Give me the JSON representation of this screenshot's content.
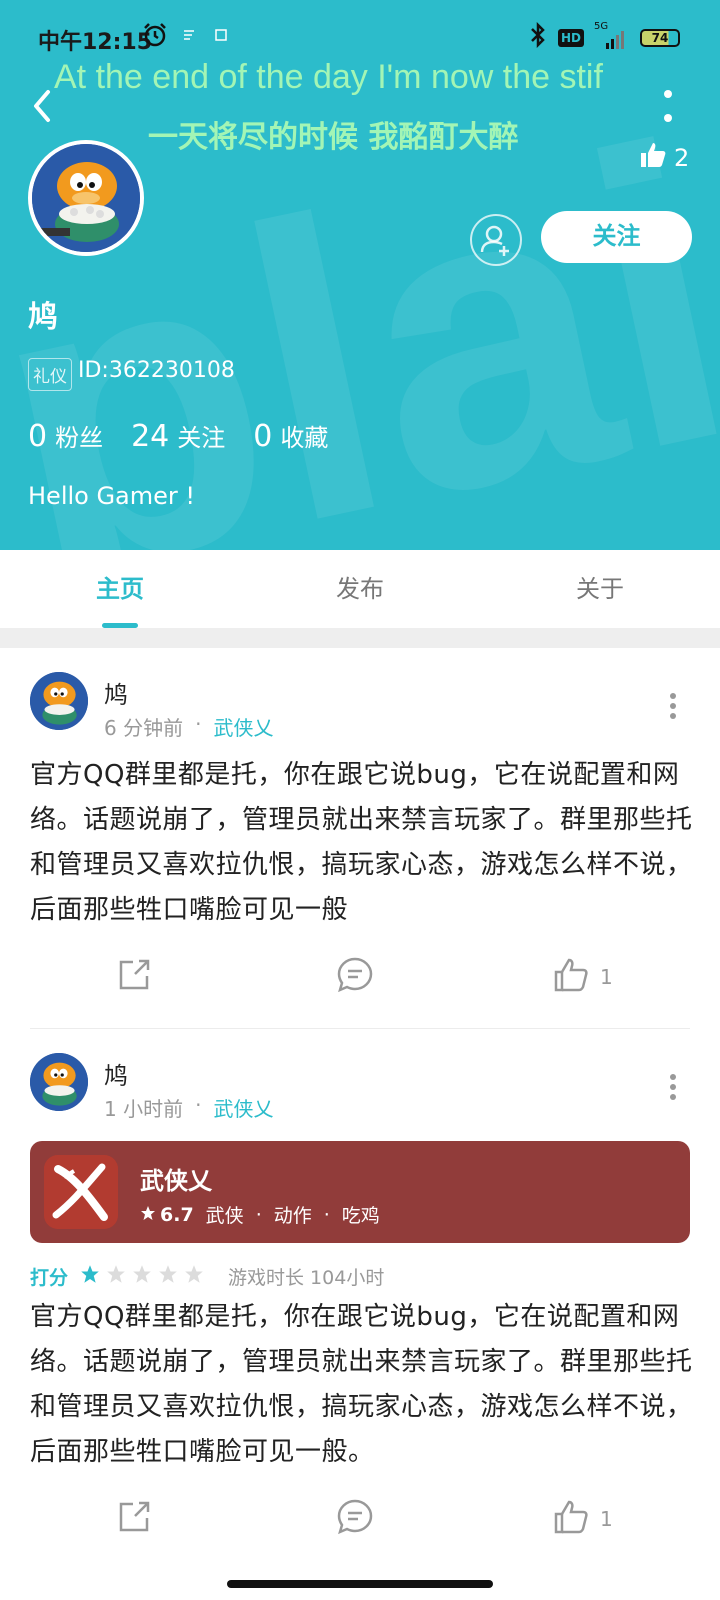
{
  "status": {
    "time": "中午12:15",
    "net_5g": "5G",
    "hd": "HD",
    "battery": "74"
  },
  "lyrics": {
    "line1": "At the end of the day I'm now the stif",
    "line2": "一天将尽的时候 我酩酊大醉"
  },
  "profile": {
    "likes": "2",
    "follow_label": "关注",
    "name": "鸠",
    "badge": "礼仪",
    "id": "ID:362230108",
    "stats": [
      {
        "num": "0",
        "label": "粉丝"
      },
      {
        "num": "24",
        "label": "关注"
      },
      {
        "num": "0",
        "label": "收藏"
      }
    ],
    "bio": "Hello Gamer !"
  },
  "tabs": [
    "主页",
    "发布",
    "关于"
  ],
  "posts": [
    {
      "author": "鸠",
      "time": "6 分钟前",
      "dot": "·",
      "game": "武侠乂",
      "text": "官方QQ群里都是托，你在跟它说bug，它在说配置和网络。话题说崩了，管理员就出来禁言玩家了。群里那些托和管理员又喜欢拉仇恨，搞玩家心态，游戏怎么样不说，后面那些牲口嘴脸可见一般",
      "like_count": "1"
    },
    {
      "author": "鸠",
      "time": "1 小时前",
      "dot": "·",
      "game": "武侠乂",
      "game_card": {
        "name": "武侠乂",
        "score": "6.7",
        "tags": [
          "武侠",
          "·",
          "动作",
          "·",
          "吃鸡"
        ]
      },
      "rating_label": "打分",
      "rating": 1,
      "playtime": "游戏时长 104小时",
      "text": "官方QQ群里都是托，你在跟它说bug，它在说配置和网络。话题说崩了，管理员就出来禁言玩家了。群里那些托和管理员又喜欢拉仇恨，搞玩家心态，游戏怎么样不说，后面那些牲口嘴脸可见一般。",
      "like_count": "1"
    }
  ],
  "colors": {
    "accent": "#2cbccb",
    "lyric": "#a3f5b5",
    "game_card": "#913c3a"
  }
}
